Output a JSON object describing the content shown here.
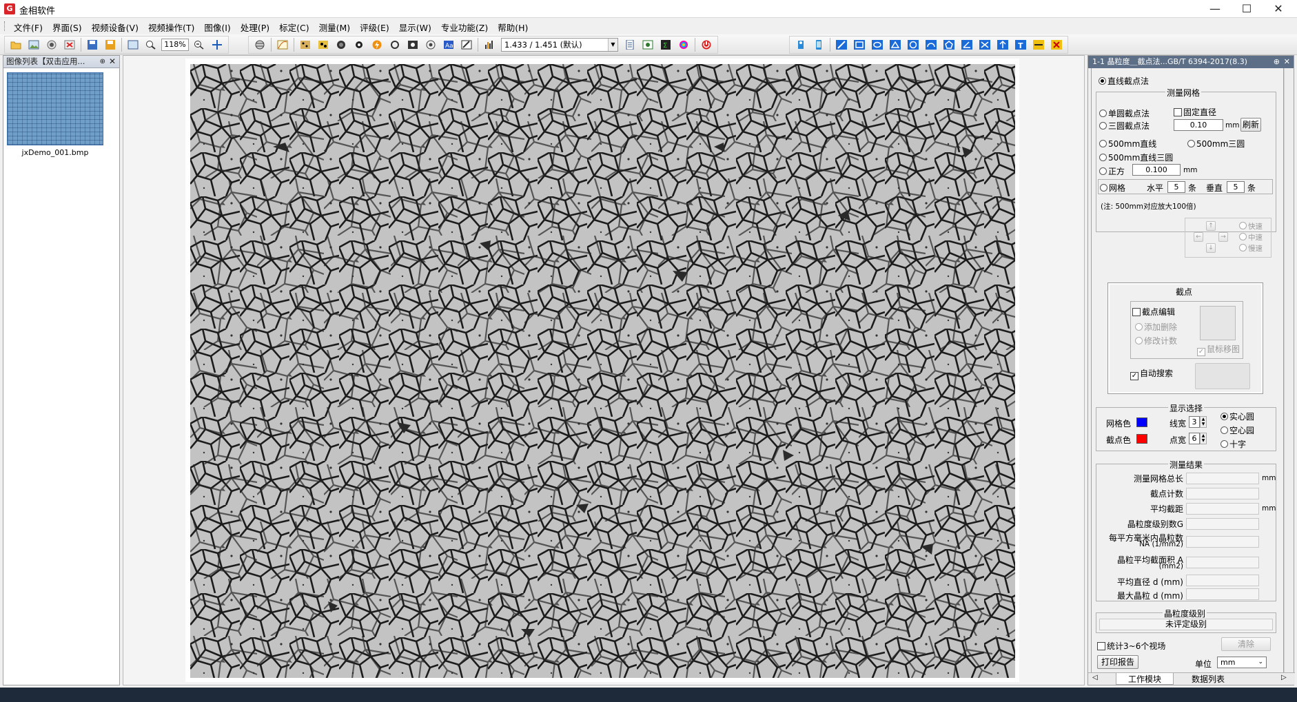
{
  "window": {
    "app_icon_letter": "G",
    "title": "金相软件",
    "minimize": "—",
    "maximize": "☐",
    "close": "✕"
  },
  "menu": [
    "文件(F)",
    "界面(S)",
    "视频设备(V)",
    "视频操作(T)",
    "图像(I)",
    "处理(P)",
    "标定(C)",
    "测量(M)",
    "评级(E)",
    "显示(W)",
    "专业功能(Z)",
    "帮助(H)"
  ],
  "toolbar": {
    "zoom": "118%",
    "calibration": "1.433 / 1.451 (默认)"
  },
  "left_panel": {
    "title": "图像列表【双击应用...",
    "files": [
      "jxDemo_001.bmp"
    ]
  },
  "right_panel": {
    "title": "1-1 晶粒度＿截点法...GB/T 6394-2017(8.3)",
    "method_line": "直线截点法",
    "grid_group": "测量网格",
    "single_circle": "单圆截点法",
    "three_circle": "三圆截点法",
    "fixed_diameter": "固定直径",
    "diameter_value": "0.10",
    "unit_mm": "mm",
    "refresh": "刷新",
    "line500": "500mm直线",
    "three_circle500": "500mm三圆",
    "line_circle500": "500mm直线三圆",
    "square": "正方",
    "square_value": "0.100",
    "grid": "网格",
    "horizontal": "水平",
    "horizontal_value": "5",
    "tiao": "条",
    "vertical": "垂直",
    "vertical_value": "5",
    "note": "(注: 500mm对应放大100倍)",
    "speed_fast": "快速",
    "speed_mid": "中速",
    "speed_slow": "慢速",
    "intercept_group": "截点",
    "intercept_edit": "截点编辑",
    "add_delete": "添加删除",
    "modify_count": "修改计数",
    "mouse_move": "鼠标移图",
    "auto_search": "自动搜索",
    "display_group": "显示选择",
    "grid_color_label": "网格色",
    "point_color_label": "截点色",
    "line_width_label": "线宽",
    "line_width_value": "3",
    "point_width_label": "点宽",
    "point_width_value": "6",
    "solid_circle": "实心圆",
    "hollow_circle": "空心园",
    "cross": "十字",
    "results_group": "测量结果",
    "results": [
      {
        "label": "测量网格总长",
        "unit": "mm"
      },
      {
        "label": "截点计数",
        "unit": ""
      },
      {
        "label": "平均截距",
        "unit": "mm"
      },
      {
        "label": "晶粒度级别数G",
        "unit": ""
      },
      {
        "label": "每平方毫米内晶粒数",
        "label2": "NA (1/mm2)",
        "unit": ""
      },
      {
        "label": "晶粒平均截面积 A",
        "label2": "(mm2)",
        "unit": ""
      },
      {
        "label": "平均直径 d (mm)",
        "unit": ""
      },
      {
        "label": "最大晶粒 d (mm)",
        "unit": ""
      }
    ],
    "grade_group": "晶粒度级别",
    "grade_value": "未评定级别",
    "stat_fields": "统计3~6个视场",
    "clear": "清除",
    "print_report": "打印报告",
    "unit_label": "单位",
    "unit_value": "mm",
    "tab_work": "工作模块",
    "tab_data": "数据列表"
  },
  "colors": {
    "grid_color": "#0000ff",
    "point_color": "#ff0000",
    "panel_header": "#5d6f86"
  }
}
